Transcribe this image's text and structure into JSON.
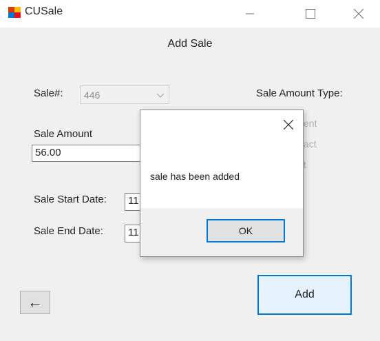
{
  "window": {
    "title": "CUSale"
  },
  "form": {
    "title": "Add Sale",
    "sale_number": {
      "label": "Sale#:",
      "value": "446"
    },
    "sale_amount_type": {
      "label": "Sale Amount Type:",
      "option_fragments": [
        "ent",
        "act",
        "t"
      ]
    },
    "sale_amount": {
      "label": "Sale Amount",
      "value": "56.00"
    },
    "start_date": {
      "label": "Sale Start Date:",
      "value": "11"
    },
    "end_date": {
      "label": "Sale End Date:",
      "value": "11"
    },
    "back_button": {
      "label": "←"
    },
    "add_button": {
      "label": "Add"
    }
  },
  "dialog": {
    "message": "sale has been added",
    "ok_label": "OK"
  }
}
